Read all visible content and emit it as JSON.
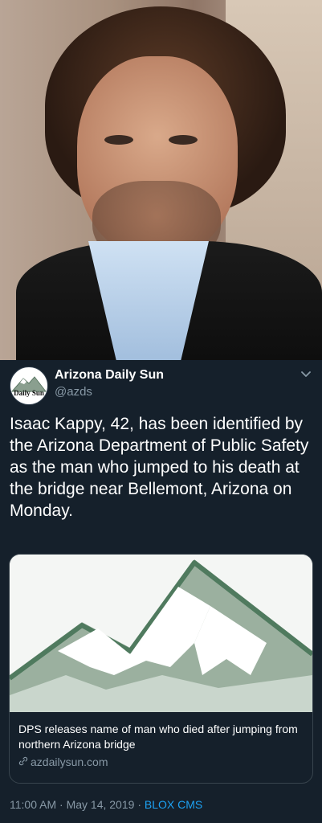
{
  "tweet": {
    "display_name": "Arizona Daily Sun",
    "handle": "@azds",
    "avatar_text": "Daily Sun",
    "text": "Isaac Kappy, 42, has been identified by the Arizona Department of Public Safety as the man who jumped to his death at the bridge near Bellemont, Arizona on Monday.",
    "menu_icon": "chevron-down-icon"
  },
  "card": {
    "title": "DPS releases name of man who died after jumping from northern Arizona bridge",
    "link_icon": "link-icon",
    "domain": "azdailysun.com"
  },
  "meta": {
    "time": "11:00 AM",
    "separator1": "·",
    "date": "May 14, 2019",
    "separator2": "·",
    "source": "BLOX CMS"
  },
  "colors": {
    "background": "#15202b",
    "secondary_text": "#8899a6",
    "accent": "#1da1f2",
    "border": "#38444d"
  }
}
